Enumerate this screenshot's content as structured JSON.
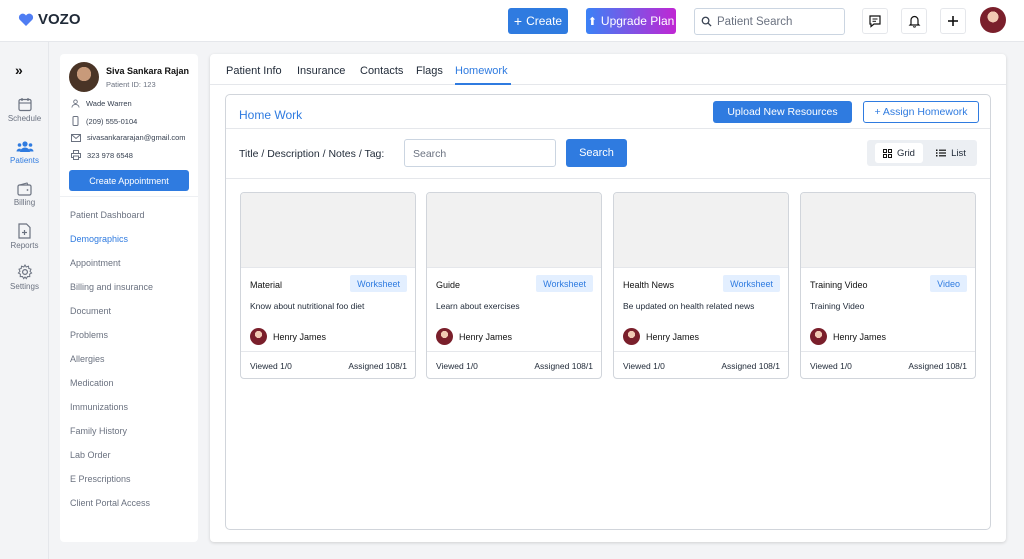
{
  "app": {
    "name": "VOZO"
  },
  "topbar": {
    "create_label": "Create",
    "upgrade_label": "Upgrade Plan",
    "search_placeholder": "Patient Search"
  },
  "rail": {
    "items": [
      {
        "label": "Schedule",
        "icon": "calendar-icon"
      },
      {
        "label": "Patients",
        "icon": "users-icon"
      },
      {
        "label": "Billing",
        "icon": "wallet-icon"
      },
      {
        "label": "Reports",
        "icon": "report-icon"
      },
      {
        "label": "Settings",
        "icon": "gear-icon"
      }
    ]
  },
  "patient": {
    "name": "Siva Sankara Rajan",
    "id_text": "Patient ID: 123",
    "contact_name": "Wade Warren",
    "phone": "(209) 555-0104",
    "email": "sivasankararajan@gmail.com",
    "fax": "323 978 6548",
    "create_appt_label": "Create Appointment",
    "menu": [
      "Patient Dashboard",
      "Demographics",
      "Appointment",
      "Billing and insurance",
      "Document",
      "Problems",
      "Allergies",
      "Medication",
      "Immunizations",
      "Family History",
      "Lab Order",
      "E Prescriptions",
      "Client Portal Access"
    ],
    "active_menu": "Demographics"
  },
  "tabs": [
    "Patient Info",
    "Insurance",
    "Contacts",
    "Flags",
    "Homework"
  ],
  "active_tab": "Homework",
  "homework": {
    "title": "Home Work",
    "upload_label": "Upload New Resources",
    "assign_label": "+ Assign Homework",
    "filter_label": "Title / Description / Notes / Tag:",
    "search_placeholder": "Search",
    "search_button": "Search",
    "view_grid": "Grid",
    "view_list": "List",
    "selected_view": "Grid",
    "cards": [
      {
        "title": "Material",
        "badge": "Worksheet",
        "description": "Know about nutritional foo diet",
        "author": "Henry James",
        "viewed": "Viewed 1/0",
        "assigned": "Assigned 108/1"
      },
      {
        "title": "Guide",
        "badge": "Worksheet",
        "description": "Learn about exercises",
        "author": "Henry James",
        "viewed": "Viewed 1/0",
        "assigned": "Assigned 108/1"
      },
      {
        "title": "Health News",
        "badge": "Worksheet",
        "description": "Be updated on health related news",
        "author": "Henry James",
        "viewed": "Viewed 1/0",
        "assigned": "Assigned 108/1"
      },
      {
        "title": "Training Video",
        "badge": "Video",
        "description": "Training Video",
        "author": "Henry James",
        "viewed": "Viewed 1/0",
        "assigned": "Assigned 108/1"
      }
    ]
  },
  "colors": {
    "accent": "#2f7be0",
    "upgrade_start": "#3b82f6",
    "upgrade_end": "#c026d3"
  }
}
